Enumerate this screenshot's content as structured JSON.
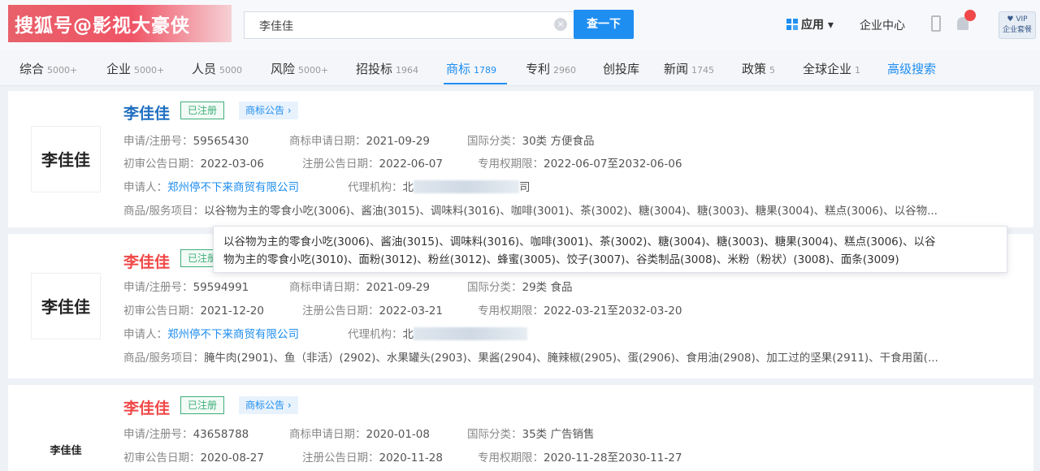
{
  "watermark": "搜狐号@影视大豪侠",
  "search": {
    "value": "李佳佳",
    "button_label": "查一下"
  },
  "header": {
    "apps_label": "应用",
    "enterprise_center": "企业中心",
    "vip_label": "VIP",
    "vip_sub": "企业套餐"
  },
  "tabs": [
    {
      "label": "综合",
      "count": "5000+"
    },
    {
      "label": "企业",
      "count": "5000+"
    },
    {
      "label": "人员",
      "count": "5000"
    },
    {
      "label": "风险",
      "count": "5000+"
    },
    {
      "label": "招投标",
      "count": "1964"
    },
    {
      "label": "商标",
      "count": "1789"
    },
    {
      "label": "专利",
      "count": "2960"
    },
    {
      "label": "创投库",
      "count": ""
    },
    {
      "label": "新闻",
      "count": "1745"
    },
    {
      "label": "政策",
      "count": "5"
    },
    {
      "label": "全球企业",
      "count": "1"
    },
    {
      "label": "高级搜索",
      "count": ""
    }
  ],
  "labels": {
    "reg_no": "申请/注册号：",
    "apply_date": "商标申请日期：",
    "intl_class": "国际分类：",
    "prelim_date": "初审公告日期：",
    "reg_date": "注册公告日期：",
    "exclusive": "专用权期限：",
    "applicant": "申请人：",
    "agency": "代理机构：",
    "goods": "商品/服务项目："
  },
  "results": [
    {
      "name": "李佳佳",
      "logo_text": "李佳佳",
      "status": "已注册",
      "notice": "商标公告",
      "reg_no": "59565430",
      "apply_date": "2021-09-29",
      "intl_class": "30类 方便食品",
      "prelim_date": "2022-03-06",
      "reg_date": "2022-06-07",
      "exclusive": "2022-06-07至2032-06-06",
      "applicant": "郑州停不下来商贸有限公司",
      "agency": "北",
      "agency_tail": "司",
      "goods": "以谷物为主的零食小吃(3006)、酱油(3015)、调味料(3016)、咖啡(3001)、茶(3002)、糖(3004)、糖(3003)、糖果(3004)、糕点(3006)、以谷物..."
    },
    {
      "name": "李佳佳",
      "logo_text": "李佳佳",
      "status": "已注册",
      "notice": "",
      "reg_no": "59594991",
      "apply_date": "2021-09-29",
      "intl_class": "29类 食品",
      "prelim_date": "2021-12-20",
      "reg_date": "2022-03-21",
      "exclusive": "2022-03-21至2032-03-20",
      "applicant": "郑州停不下来商贸有限公司",
      "agency": "北",
      "agency_tail": "",
      "goods": "腌牛肉(2901)、鱼（非活）(2902)、水果罐头(2903)、果酱(2904)、腌辣椒(2905)、蛋(2906)、食用油(2908)、加工过的坚果(2911)、干食用菌(..."
    },
    {
      "name": "李佳佳",
      "logo_text": "李佳佳",
      "status": "已注册",
      "notice": "商标公告",
      "reg_no": "43658788",
      "apply_date": "2020-01-08",
      "intl_class": "35类 广告销售",
      "prelim_date": "2020-08-27",
      "reg_date": "2020-11-28",
      "exclusive": "2020-11-28至2030-11-27"
    }
  ],
  "tooltip": {
    "line1": "以谷物为主的零食小吃(3006)、酱油(3015)、调味料(3016)、咖啡(3001)、茶(3002)、糖(3004)、糖(3003)、糖果(3004)、糕点(3006)、以谷",
    "line2": "物为主的零食小吃(3010)、面粉(3012)、粉丝(3012)、蜂蜜(3005)、饺子(3007)、谷类制品(3008)、米粉（粉状）(3008)、面条(3009)"
  },
  "colors": {
    "accent": "#1f8ef1",
    "name_highlight": "#f04848",
    "registered": "#3fae7a"
  }
}
